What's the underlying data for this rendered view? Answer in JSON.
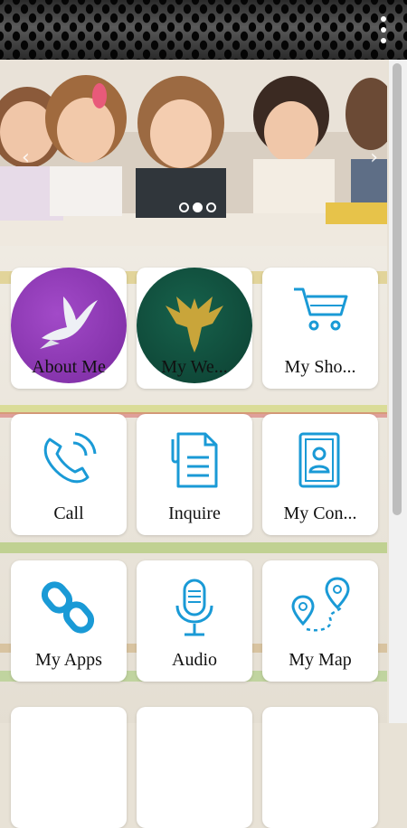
{
  "carousel": {
    "prev_arrow": "‹",
    "next_arrow": "›",
    "slides": 3,
    "active_slide": 2
  },
  "tiles": [
    {
      "label": "About Me",
      "icon": "dove-icon"
    },
    {
      "label": "My We...",
      "icon": "eagle-icon"
    },
    {
      "label": "My Sho...",
      "icon": "shopping-cart-icon"
    },
    {
      "label": "Call",
      "icon": "phone-icon"
    },
    {
      "label": "Inquire",
      "icon": "document-icon"
    },
    {
      "label": "My Con...",
      "icon": "contact-book-icon"
    },
    {
      "label": "My Apps",
      "icon": "link-icon"
    },
    {
      "label": "Audio",
      "icon": "microphone-icon"
    },
    {
      "label": "My Map",
      "icon": "map-pins-icon"
    }
  ],
  "colors": {
    "accent": "#1a9ad6",
    "about_circle": "#8a35b0",
    "website_circle": "#0f4a3a",
    "gold": "#c9a53a"
  }
}
